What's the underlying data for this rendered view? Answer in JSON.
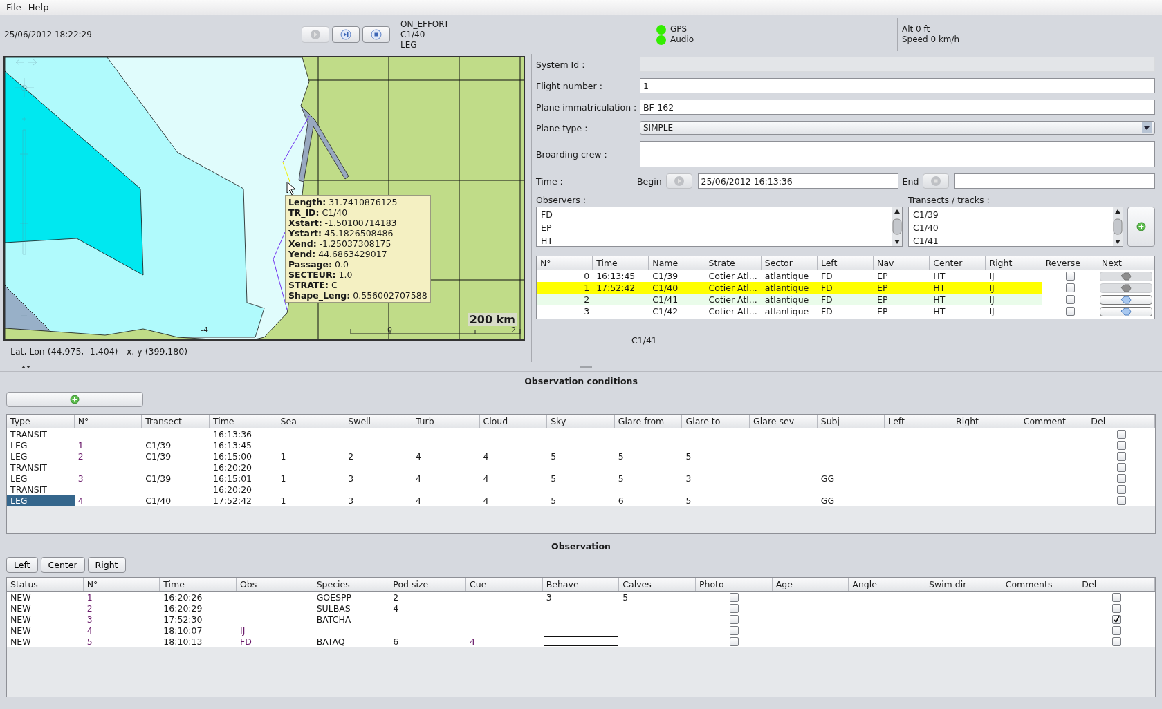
{
  "menu": [
    "File",
    "Help"
  ],
  "top_bar": {
    "datetime": "25/06/2012 18:22:29",
    "controls": [
      {
        "kind": "play",
        "disabled": true
      },
      {
        "kind": "next",
        "disabled": false
      },
      {
        "kind": "stop",
        "disabled": false
      }
    ],
    "status_lines": [
      "ON_EFFORT",
      "C1/40",
      "LEG"
    ],
    "indicators": [
      {
        "label": "GPS",
        "color": "#33ee00"
      },
      {
        "label": "Audio",
        "color": "#33ee00"
      }
    ],
    "flight_info": [
      "Alt 0 ft",
      "Speed 0 km/h"
    ]
  },
  "map": {
    "tooltip": [
      "**Length:** 31.7410876125",
      "**TR_ID:** C1/40",
      "**Xstart:** -1.50100714183",
      "**Ystart:** 45.1826508486",
      "**Xend:** -1.25037308175",
      "**Yend:** 44.6863429017",
      "**Passage:** 0.0",
      "**SECTEUR:** 1.0",
      "**STRATE:** C",
      "**Shape_Leng:** 0.556002707588"
    ],
    "scale": "200 km",
    "axis_labels": [
      "-4",
      "0",
      "2"
    ],
    "position": "Lat, Lon (44.975, -1.404) - x, y (399,180)"
  },
  "form": {
    "fields": [
      {
        "label": "System Id :",
        "kind": "readonly"
      },
      {
        "label": "Flight number :",
        "kind": "text",
        "value": "1"
      },
      {
        "label": "Plane immatriculation :",
        "kind": "text",
        "value": "BF-162"
      },
      {
        "label": "Plane type :",
        "kind": "select",
        "value": "SIMPLE"
      },
      {
        "label": "Broarding crew :",
        "kind": "textarea"
      }
    ],
    "time": {
      "label": "Time :",
      "begin_label": "Begin",
      "begin_value": "25/06/2012 16:13:36",
      "end_label": "End"
    },
    "observers": {
      "label": "Observers :",
      "items": [
        "FD",
        "EP",
        "HT"
      ]
    },
    "transects": {
      "label": "Transects / tracks :",
      "items": [
        "C1/39",
        "C1/40",
        "C1/41"
      ]
    }
  },
  "legs": {
    "columns": [
      "N°",
      "Time",
      "Name",
      "Strate",
      "Sector",
      "Left",
      "Nav",
      "Center",
      "Right",
      "Reverse",
      "Next"
    ],
    "rows": [
      {
        "cells": [
          "0",
          "16:13:45",
          "C1/39",
          "Cotier Atl...",
          "atlantique",
          "FD",
          "EP",
          "HT",
          "IJ"
        ],
        "selected": false,
        "upcoming": false,
        "reverse": false,
        "next_disabled": true
      },
      {
        "cells": [
          "1",
          "17:52:42",
          "C1/40",
          "Cotier Atl...",
          "atlantique",
          "FD",
          "EP",
          "HT",
          "IJ"
        ],
        "selected": true,
        "upcoming": false,
        "reverse": false,
        "next_disabled": true
      },
      {
        "cells": [
          "2",
          "",
          "C1/41",
          "Cotier Atl...",
          "atlantique",
          "FD",
          "EP",
          "HT",
          "IJ"
        ],
        "selected": false,
        "upcoming": true,
        "reverse": false,
        "next_disabled": false
      },
      {
        "cells": [
          "3",
          "",
          "C1/42",
          "Cotier Atl...",
          "atlantique",
          "FD",
          "EP",
          "HT",
          "IJ"
        ],
        "selected": false,
        "upcoming": false,
        "reverse": false,
        "next_disabled": false
      }
    ],
    "caption": "C1/41"
  },
  "conditions": {
    "title": "Observation conditions",
    "columns": [
      "Type",
      "N°",
      "Transect",
      "Time",
      "Sea",
      "Swell",
      "Turb",
      "Cloud",
      "Sky",
      "Glare from",
      "Glare to",
      "Glare sev",
      "Subj",
      "Left",
      "Right",
      "Comment",
      "Del"
    ],
    "rows": [
      {
        "cells": [
          "TRANSIT",
          "",
          "",
          "16:13:36",
          "",
          "",
          "",
          "",
          "",
          "",
          "",
          "",
          "",
          "",
          "",
          ""
        ],
        "selected": false,
        "del": false
      },
      {
        "cells": [
          "LEG",
          "1",
          "C1/39",
          "16:13:45",
          "",
          "",
          "",
          "",
          "",
          "",
          "",
          "",
          "",
          "",
          "",
          ""
        ],
        "selected": false,
        "del": false
      },
      {
        "cells": [
          "LEG",
          "2",
          "C1/39",
          "16:15:00",
          "1",
          "2",
          "4",
          "4",
          "5",
          "5",
          "5",
          "",
          "",
          "",
          "",
          ""
        ],
        "selected": false,
        "del": false
      },
      {
        "cells": [
          "TRANSIT",
          "",
          "",
          "16:20:20",
          "",
          "",
          "",
          "",
          "",
          "",
          "",
          "",
          "",
          "",
          "",
          ""
        ],
        "selected": false,
        "del": false
      },
      {
        "cells": [
          "LEG",
          "3",
          "C1/39",
          "16:15:01",
          "1",
          "3",
          "4",
          "4",
          "5",
          "5",
          "3",
          "",
          "GG",
          "",
          "",
          ""
        ],
        "selected": false,
        "del": false
      },
      {
        "cells": [
          "TRANSIT",
          "",
          "",
          "16:20:20",
          "",
          "",
          "",
          "",
          "",
          "",
          "",
          "",
          "",
          "",
          "",
          ""
        ],
        "selected": false,
        "del": false
      },
      {
        "cells": [
          "LEG",
          "4",
          "C1/40",
          "17:52:42",
          "1",
          "3",
          "4",
          "4",
          "5",
          "6",
          "5",
          "",
          "GG",
          "",
          "",
          ""
        ],
        "selected": true,
        "del": false
      }
    ]
  },
  "observation": {
    "title": "Observation",
    "buttons": [
      "Left",
      "Center",
      "Right"
    ],
    "columns": [
      "Status",
      "N°",
      "Time",
      "Obs",
      "Species",
      "Pod size",
      "Cue",
      "Behave",
      "Calves",
      "Photo",
      "Age",
      "Angle",
      "Swim dir",
      "Comments",
      "Del"
    ],
    "rows": [
      {
        "cells": [
          "NEW",
          "1",
          "16:20:26",
          "",
          "GOESPP",
          "2",
          "",
          "3",
          "5"
        ],
        "photo": false,
        "del": false,
        "editing": false
      },
      {
        "cells": [
          "NEW",
          "2",
          "16:20:29",
          "",
          "SULBAS",
          "4",
          "",
          "",
          ""
        ],
        "photo": false,
        "del": false,
        "editing": false
      },
      {
        "cells": [
          "NEW",
          "3",
          "17:52:30",
          "",
          "BATCHA",
          "",
          "",
          "",
          ""
        ],
        "photo": false,
        "del": true,
        "editing": false
      },
      {
        "cells": [
          "NEW",
          "4",
          "18:10:07",
          "IJ",
          "",
          "",
          "",
          "",
          ""
        ],
        "photo": false,
        "del": false,
        "editing": false
      },
      {
        "cells": [
          "NEW",
          "5",
          "18:10:13",
          "FD",
          "BATAQ",
          "6",
          "4",
          "",
          ""
        ],
        "photo": false,
        "del": false,
        "editing": true
      }
    ]
  }
}
